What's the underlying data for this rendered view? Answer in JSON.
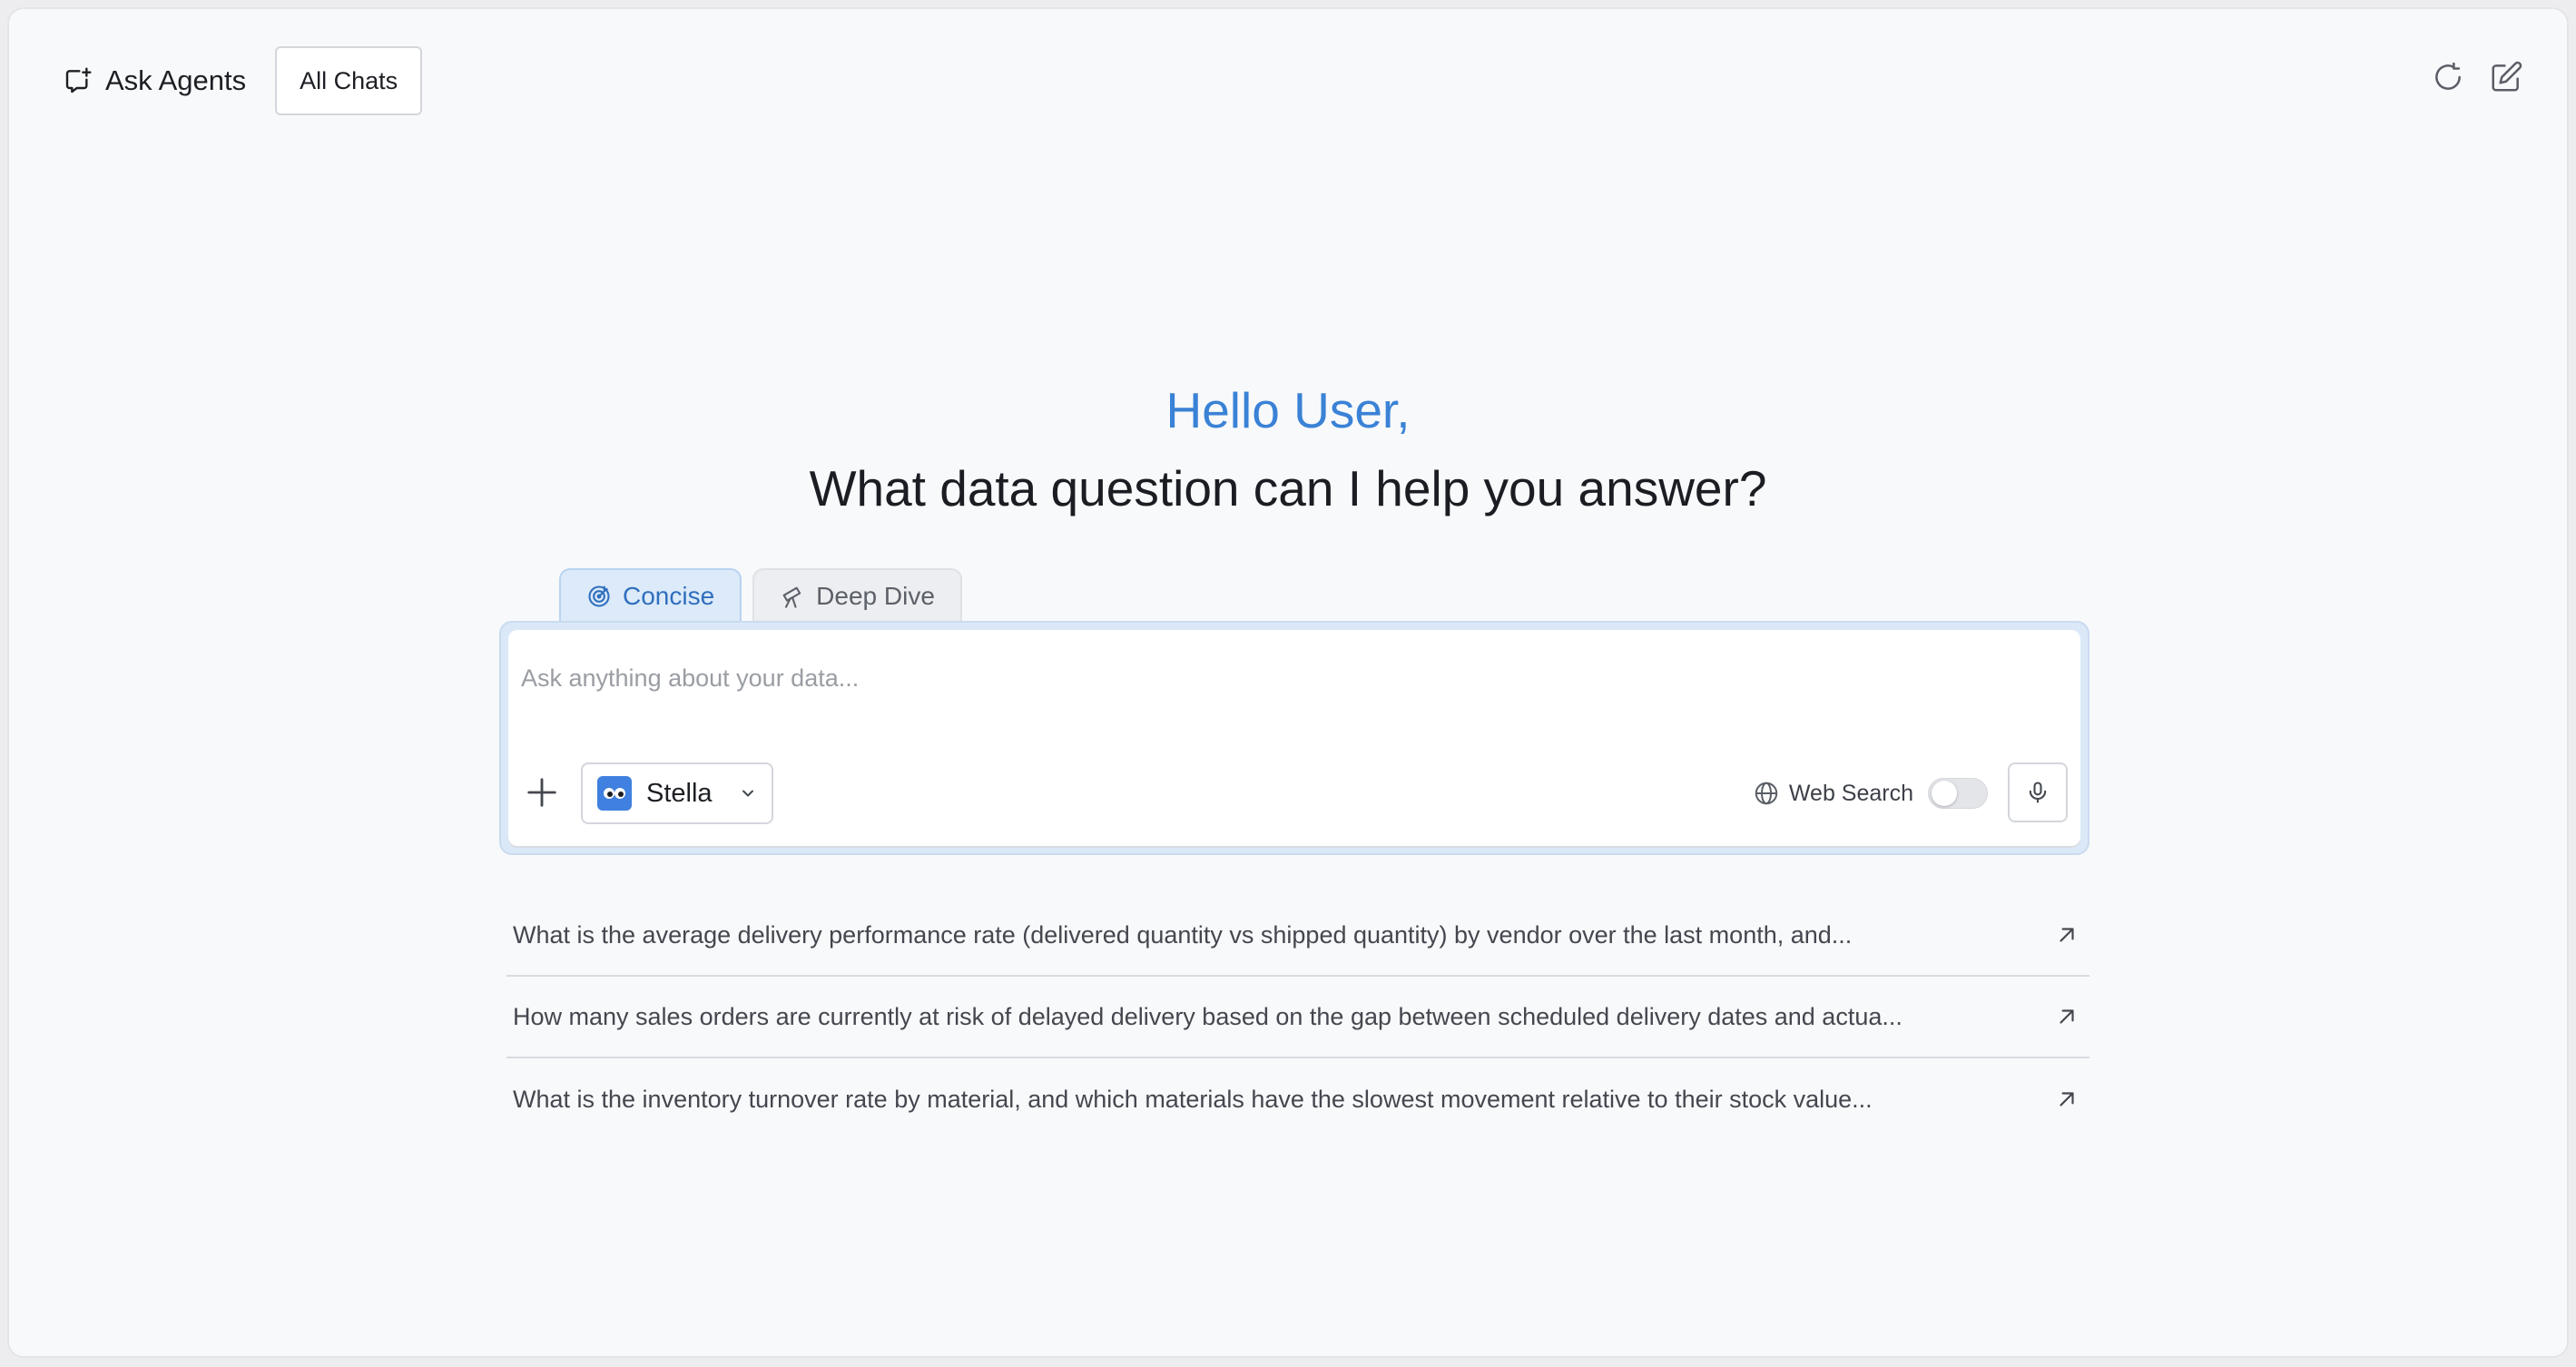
{
  "header": {
    "title": "Ask Agents",
    "all_chats_label": "All Chats",
    "icons": [
      "chat-plus-icon",
      "refresh-icon",
      "edit-icon"
    ]
  },
  "greeting": "Hello User,",
  "headline": "What data question can I help you answer?",
  "tabs": [
    {
      "label": "Concise",
      "icon": "target-icon",
      "active": true
    },
    {
      "label": "Deep Dive",
      "icon": "telescope-icon",
      "active": false
    }
  ],
  "input": {
    "placeholder": "Ask anything about your data...",
    "value": ""
  },
  "agent": {
    "name": "Stella",
    "avatar": "robot-avatar"
  },
  "web_search": {
    "label": "Web Search",
    "enabled": false
  },
  "suggestions": [
    "What is the average delivery performance rate (delivered quantity vs shipped quantity) by vendor over the last month, and...",
    "How many sales orders are currently at risk of delayed delivery based on the gap between scheduled delivery dates and actua...",
    "What is the inventory turnover rate by material, and which materials have the slowest movement relative to their stock value..."
  ],
  "colors": {
    "accent": "#3a82d6",
    "active_tab_bg": "#dceaf9",
    "avatar_bg": "#3f80e0"
  }
}
